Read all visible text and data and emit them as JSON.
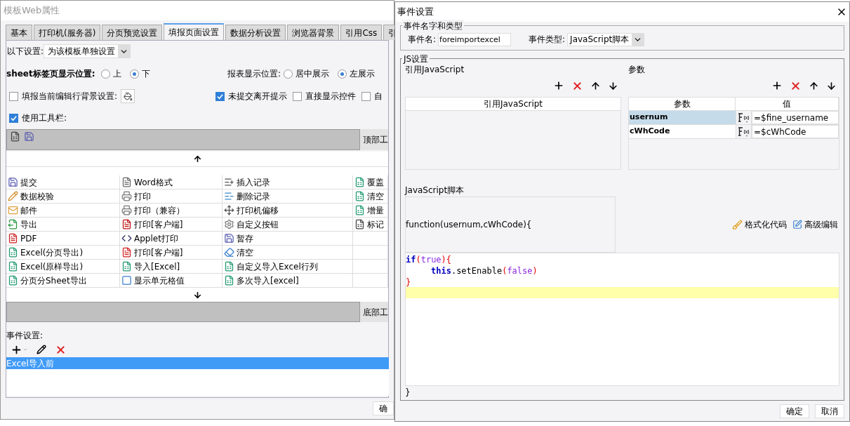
{
  "main_window": {
    "title": "模板Web属性",
    "tabs": [
      {
        "label": "基本",
        "selected": false
      },
      {
        "label": "打印机(服务器)",
        "selected": false
      },
      {
        "label": "分页预览设置",
        "selected": false
      },
      {
        "label": "填报页面设置",
        "selected": true
      },
      {
        "label": "数据分析设置",
        "selected": false
      },
      {
        "label": "浏览器背景",
        "selected": false
      },
      {
        "label": "引用Css",
        "selected": false
      },
      {
        "label": "引",
        "selected": false
      }
    ],
    "settings_scope": {
      "label": "以下设置:",
      "value": "为该模板单独设置"
    },
    "sheet_position": {
      "label": "sheet标签页显示位置:",
      "options": [
        {
          "label": "上",
          "selected": false
        },
        {
          "label": "下",
          "selected": true
        }
      ]
    },
    "report_position": {
      "label": "报表显示位置:",
      "options": [
        {
          "label": "居中展示",
          "selected": false
        },
        {
          "label": "左展示",
          "selected": true
        }
      ]
    },
    "row_background": {
      "label": "填报当前编辑行背景设置:",
      "checked": false
    },
    "options": [
      {
        "label": "未提交离开提示",
        "checked": true
      },
      {
        "label": "直接显示控件",
        "checked": false
      },
      {
        "label": "自",
        "checked": false
      }
    ],
    "use_toolbar": {
      "label": "使用工具栏:",
      "checked": true
    },
    "top_toolbar": {
      "label": "顶部工",
      "icons": [
        {
          "kind": "sheet"
        },
        {
          "kind": "save"
        }
      ]
    },
    "buttons_grid": [
      [
        {
          "label": "提交",
          "kind": "save"
        },
        {
          "label": "Word格式",
          "kind": "word"
        },
        {
          "label": "插入记录",
          "kind": "insert"
        },
        {
          "label": "覆盖",
          "kind": "excel"
        }
      ],
      [
        {
          "label": "数据校验",
          "kind": "pencil"
        },
        {
          "label": "打印",
          "kind": "printer"
        },
        {
          "label": "删除记录",
          "kind": "delete"
        },
        {
          "label": "清空",
          "kind": "excel"
        }
      ],
      [
        {
          "label": "邮件",
          "kind": "mail"
        },
        {
          "label": "打印（兼容）",
          "kind": "printer"
        },
        {
          "label": "打印机偏移",
          "kind": "move"
        },
        {
          "label": "增量",
          "kind": "excel"
        }
      ],
      [
        {
          "label": "导出",
          "kind": "export"
        },
        {
          "label": "打印[客户端]",
          "kind": "fr"
        },
        {
          "label": "自定义按钮",
          "kind": "gear"
        },
        {
          "label": "标记",
          "kind": "sheet"
        }
      ],
      [
        {
          "label": "PDF",
          "kind": "pdf"
        },
        {
          "label": "Applet打印",
          "kind": "applet"
        },
        {
          "label": "暂存",
          "kind": "save"
        }
      ],
      [
        {
          "label": "Excel(分页导出)",
          "kind": "excel"
        },
        {
          "label": "打印[客户端]",
          "kind": "pdf"
        },
        {
          "label": "清空",
          "kind": "eraser"
        }
      ],
      [
        {
          "label": "Excel(原样导出)",
          "kind": "excel"
        },
        {
          "label": "导入[Excel]",
          "kind": "excel"
        },
        {
          "label": "自定义导入Excel行列",
          "kind": "excel"
        }
      ],
      [
        {
          "label": "分页分Sheet导出",
          "kind": "excel"
        },
        {
          "label": "显示单元格值",
          "kind": "window"
        },
        {
          "label": "多次导入[excel]",
          "kind": "excel"
        }
      ]
    ],
    "bottom_toolbar": {
      "label": "底部工"
    },
    "events": {
      "label": "事件设置:",
      "items": [
        {
          "label": "Excel导入前",
          "selected": true
        }
      ]
    },
    "ok_button": "确"
  },
  "event_dialog": {
    "title": "事件设置",
    "name_group": {
      "title": "事件名字和类型",
      "name_label": "事件名:",
      "name_value": "foreimportexcel",
      "type_label": "事件类型:",
      "type_value": "JavaScript脚本"
    },
    "js_group": {
      "title": "JS设置",
      "references": {
        "title": "引用JavaScript",
        "column": "引用JavaScript"
      },
      "parameters": {
        "title": "参数",
        "columns": [
          "参数",
          "值"
        ],
        "rows": [
          {
            "name": "usernum",
            "value": "=$fine_username",
            "selected": true
          },
          {
            "name": "cWhCode",
            "value": "=$cWhCode",
            "selected": false
          }
        ]
      },
      "script": {
        "title": "JavaScript脚本",
        "signature": "function(usernum,cWhCode){",
        "format_button": "格式化代码",
        "advanced_button": "高级编辑",
        "lines": [
          {
            "highlighted": false,
            "tokens": [
              {
                "text": "if",
                "kind": "keyword"
              },
              {
                "text": "(",
                "kind": "bracket"
              },
              {
                "text": "true",
                "kind": "literal"
              },
              {
                "text": ")",
                "kind": "bracket"
              },
              {
                "text": "{",
                "kind": "bracket"
              }
            ]
          },
          {
            "highlighted": false,
            "indented": true,
            "tokens": [
              {
                "text": "this",
                "kind": "keyword"
              },
              {
                "text": ".setEnable",
                "kind": "plain"
              },
              {
                "text": "(",
                "kind": "bracket"
              },
              {
                "text": "false",
                "kind": "literal"
              },
              {
                "text": ")",
                "kind": "bracket"
              }
            ]
          },
          {
            "highlighted": false,
            "tokens": [
              {
                "text": "}",
                "kind": "bracket"
              }
            ]
          },
          {
            "highlighted": true
          }
        ],
        "closing": "}"
      }
    },
    "ok_button": "确定",
    "cancel_button": "取消"
  }
}
